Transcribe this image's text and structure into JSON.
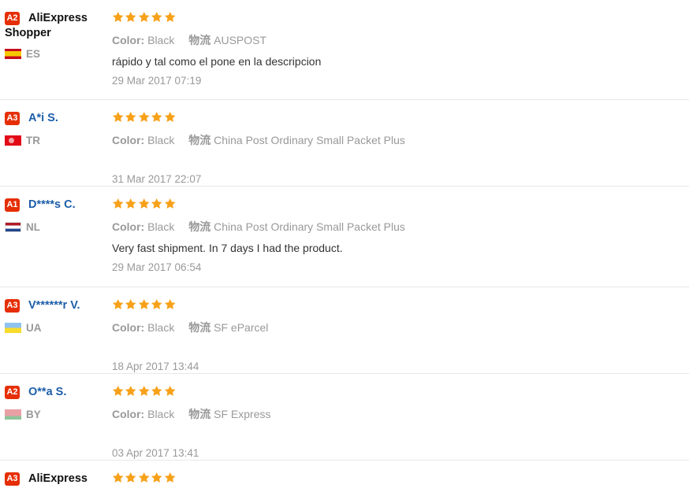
{
  "reviews": [
    {
      "level": "A2",
      "name": "AliExpress",
      "name_cont": "Shopper",
      "country": "ES",
      "flag": "es",
      "stars": 5,
      "color_label": "Color:",
      "color": "Black",
      "ship_label": "物流",
      "ship": "AUSPOST",
      "feedback": "rápido y tal como el pone en la descripcion",
      "date": "29 Mar 2017 07:19"
    },
    {
      "level": "A3",
      "name": "A*i S.",
      "country": "TR",
      "flag": "tr",
      "stars": 5,
      "color_label": "Color:",
      "color": "Black",
      "ship_label": "物流",
      "ship": "China Post Ordinary Small Packet Plus",
      "feedback": "",
      "date": "31 Mar 2017 22:07"
    },
    {
      "level": "A1",
      "name": "D****s C.",
      "country": "NL",
      "flag": "nl",
      "stars": 5,
      "color_label": "Color:",
      "color": "Black",
      "ship_label": "物流",
      "ship": "China Post Ordinary Small Packet Plus",
      "feedback": "Very fast shipment. In 7 days I had the product.",
      "date": "29 Mar 2017 06:54"
    },
    {
      "level": "A3",
      "name": "V******r V.",
      "country": "UA",
      "flag": "ua",
      "stars": 5,
      "color_label": "Color:",
      "color": "Black",
      "ship_label": "物流",
      "ship": "SF eParcel",
      "feedback": "",
      "date": "18 Apr 2017 13:44"
    },
    {
      "level": "A2",
      "name": "O**a S.",
      "country": "BY",
      "flag": "by",
      "stars": 5,
      "color_label": "Color:",
      "color": "Black",
      "ship_label": "物流",
      "ship": "SF Express",
      "feedback": "",
      "date": "03 Apr 2017 13:41"
    },
    {
      "level": "A3",
      "name": "AliExpress",
      "stars": 5
    }
  ],
  "colors": {
    "badge": "#e62e04",
    "star": "#f7a11a",
    "name": "#1c5ea8",
    "muted": "#999999"
  }
}
